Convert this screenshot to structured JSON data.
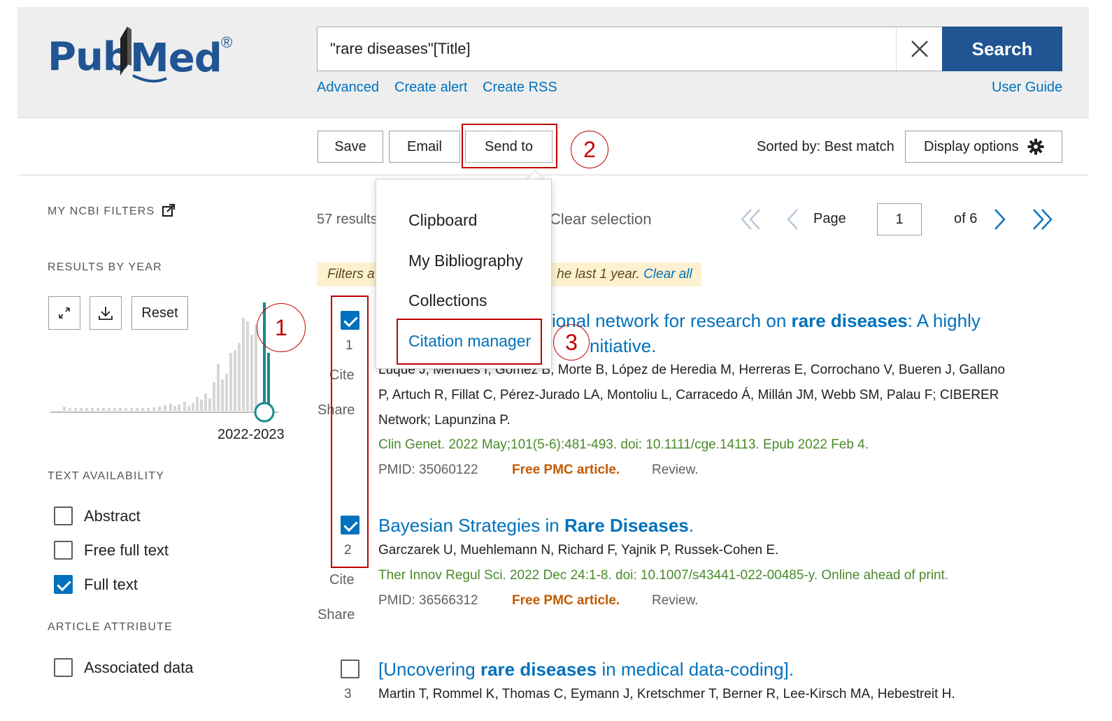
{
  "header": {
    "logo_text": "PubMed",
    "logo_reg": "®",
    "search_value": "\"rare diseases\"[Title]",
    "search_button": "Search",
    "links": {
      "advanced": "Advanced",
      "create_alert": "Create alert",
      "create_rss": "Create RSS",
      "user_guide": "User Guide"
    }
  },
  "toolbar": {
    "save": "Save",
    "email": "Email",
    "send_to": "Send to",
    "sorted_by": "Sorted by: Best match",
    "display_options": "Display options"
  },
  "annotations": {
    "one": "1",
    "two": "2",
    "three": "3"
  },
  "send_to_menu": {
    "items": [
      "Clipboard",
      "My Bibliography",
      "Collections",
      "Citation manager"
    ]
  },
  "sidebar": {
    "my_ncbi_filters": "MY NCBI FILTERS",
    "results_by_year": "RESULTS BY YEAR",
    "reset": "Reset",
    "year_range": "2022-2023",
    "text_availability": "TEXT AVAILABILITY",
    "text_options": [
      {
        "label": "Abstract",
        "checked": false
      },
      {
        "label": "Free full text",
        "checked": false
      },
      {
        "label": "Full text",
        "checked": true
      }
    ],
    "article_attribute": "ARTICLE ATTRIBUTE",
    "attribute_options": [
      {
        "label": "Associated data",
        "checked": false
      }
    ]
  },
  "results_bar": {
    "count": "57 results",
    "clear_selection": "Clear selection",
    "page_label": "Page",
    "page_value": "1",
    "of_pages": "of 6"
  },
  "filter_banner": {
    "prefix": "Filters a",
    "suffix": "he last 1 year.",
    "clear_all": "Clear all"
  },
  "results": [
    {
      "num": "1",
      "checked": true,
      "title_line1_pre": "ional network for research on ",
      "title_line1_bold": "rare diseases",
      "title_line1_post": ": A highly",
      "title_line2": "nitiative.",
      "authors_line1": "Luque J, Mendes I, Gómez B, Morte B, López de Heredia M, Herreras E, Corrochano V, Bueren J, Gallano",
      "authors_line2": "P, Artuch R, Fillat C, Pérez-Jurado LA, Montoliu L, Carracedo Á, Millán JM, Webb SM, Palau F; CIBERER",
      "authors_line3": "Network; Lapunzina P.",
      "journal": "Clin Genet. 2022 May;101(5-6):481-493. doi: 10.1111/cge.14113. Epub 2022 Feb 4.",
      "pmid": "PMID: 35060122",
      "free_pmc": "Free PMC article.",
      "review": "Review.",
      "cite": "Cite",
      "share": "Share"
    },
    {
      "num": "2",
      "checked": true,
      "title_pre": "Bayesian Strategies in ",
      "title_bold": "Rare Diseases",
      "title_post": ".",
      "authors": "Garczarek U, Muehlemann N, Richard F, Yajnik P, Russek-Cohen E.",
      "journal": "Ther Innov Regul Sci. 2022 Dec 24:1-8. doi: 10.1007/s43441-022-00485-y. Online ahead of print.",
      "pmid": "PMID: 36566312",
      "free_pmc": "Free PMC article.",
      "review": "Review.",
      "cite": "Cite",
      "share": "Share"
    },
    {
      "num": "3",
      "checked": false,
      "title_pre": "[Uncovering ",
      "title_bold": "rare diseases",
      "title_post": " in medical data-coding].",
      "authors": "Martin T, Rommel K, Thomas C, Eymann J, Kretschmer T, Berner R, Lee-Kirsch MA, Hebestreit H."
    }
  ],
  "colors": {
    "brand_blue": "#205493",
    "link_blue": "#0071bc",
    "annotation_red": "#c00000",
    "chart_teal": "#1a8a8a",
    "journal_green": "#4a8a2a",
    "free_pmc_orange": "#c05a00",
    "banner_yellow": "#fdf1cf"
  }
}
